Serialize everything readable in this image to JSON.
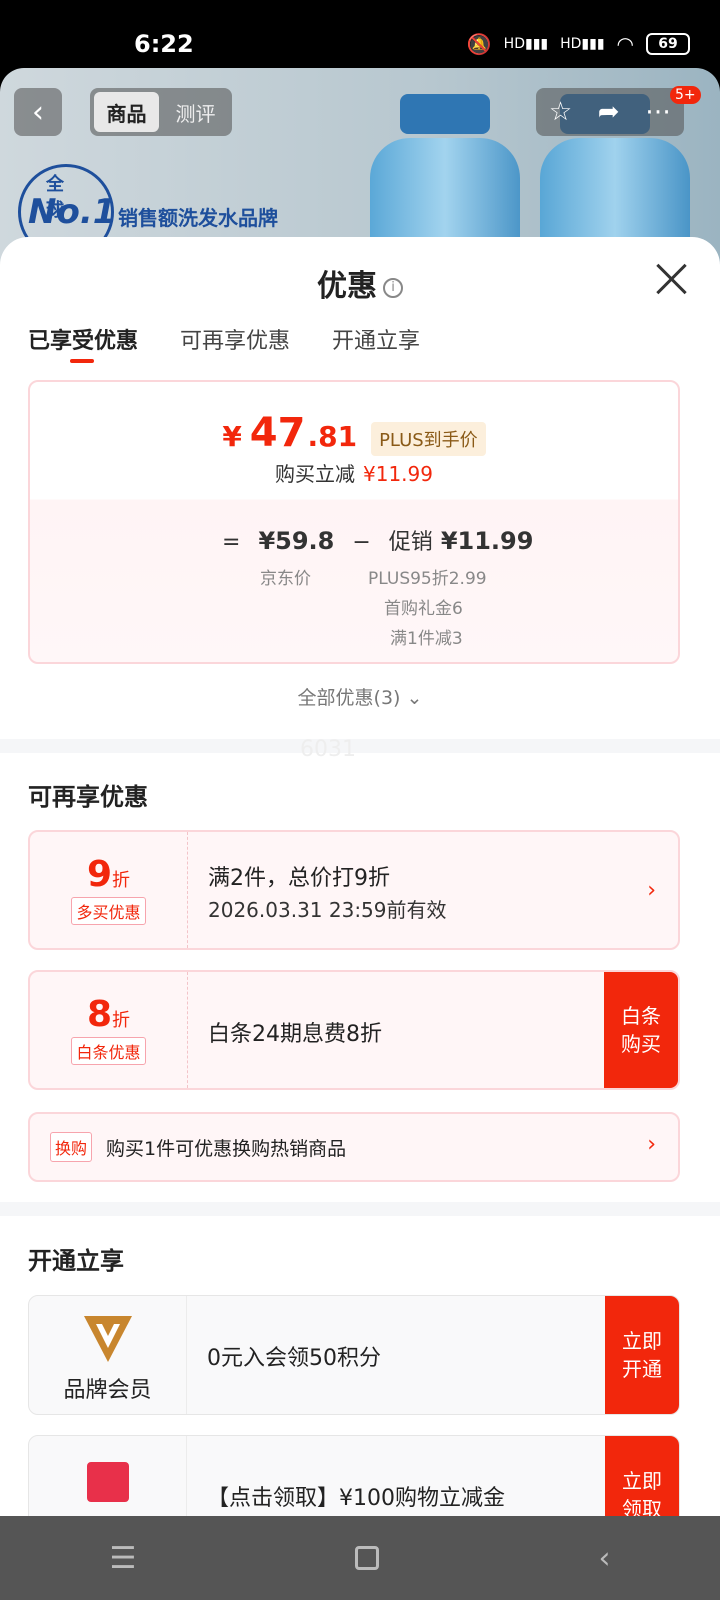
{
  "status_bar": {
    "time": "6:22",
    "signal1": "HD",
    "signal2": "HD",
    "battery": "69"
  },
  "product_header": {
    "tabs": [
      "商品",
      "测评"
    ],
    "badge": "5+",
    "logo_top": "全球",
    "logo_big": "No.1",
    "slogan": "销售额洗发水品牌"
  },
  "sheet": {
    "title": "优惠",
    "tabs": [
      "已享受优惠",
      "可再享优惠",
      "开通立享"
    ],
    "price": {
      "yuan": "¥",
      "integer": "47",
      "decimal": ".81",
      "plus_label": "PLUS到手价",
      "reduce_label": "购买立减",
      "reduce_value": "¥11.99",
      "eq": "=",
      "jd_price": "¥59.8",
      "minus": "−",
      "promo_label": "促销",
      "promo_value": "¥11.99",
      "jd_price_label": "京东价",
      "promo_details": [
        "PLUS95折2.99",
        "首购礼金6",
        "满1件减3"
      ]
    },
    "all_discounts": "全部优惠(3)",
    "watermark": "6031",
    "available": {
      "title": "可再享优惠",
      "offers": [
        {
          "num": "9",
          "unit": "折",
          "tag": "多买优惠",
          "text": "满2件，总价打9折",
          "sub": "2026.03.31 23:59前有效"
        },
        {
          "num": "8",
          "unit": "折",
          "tag": "白条优惠",
          "text": "白条24期息费8折",
          "button": [
            "白条",
            "购买"
          ]
        }
      ],
      "swap": {
        "tag": "换购",
        "text": "购买1件可优惠换购热销商品"
      }
    },
    "open": {
      "title": "开通立享",
      "items": [
        {
          "label": "品牌会员",
          "text": "0元入会领50积分",
          "button": [
            "立即",
            "开通"
          ]
        },
        {
          "label": "",
          "text": "【点击领取】¥100购物立减金",
          "button": [
            "立即",
            "领取"
          ]
        }
      ]
    }
  },
  "colors": {
    "accent": "#f2270c",
    "plus_bg": "#fcefdc",
    "gold": "#c8862e"
  }
}
